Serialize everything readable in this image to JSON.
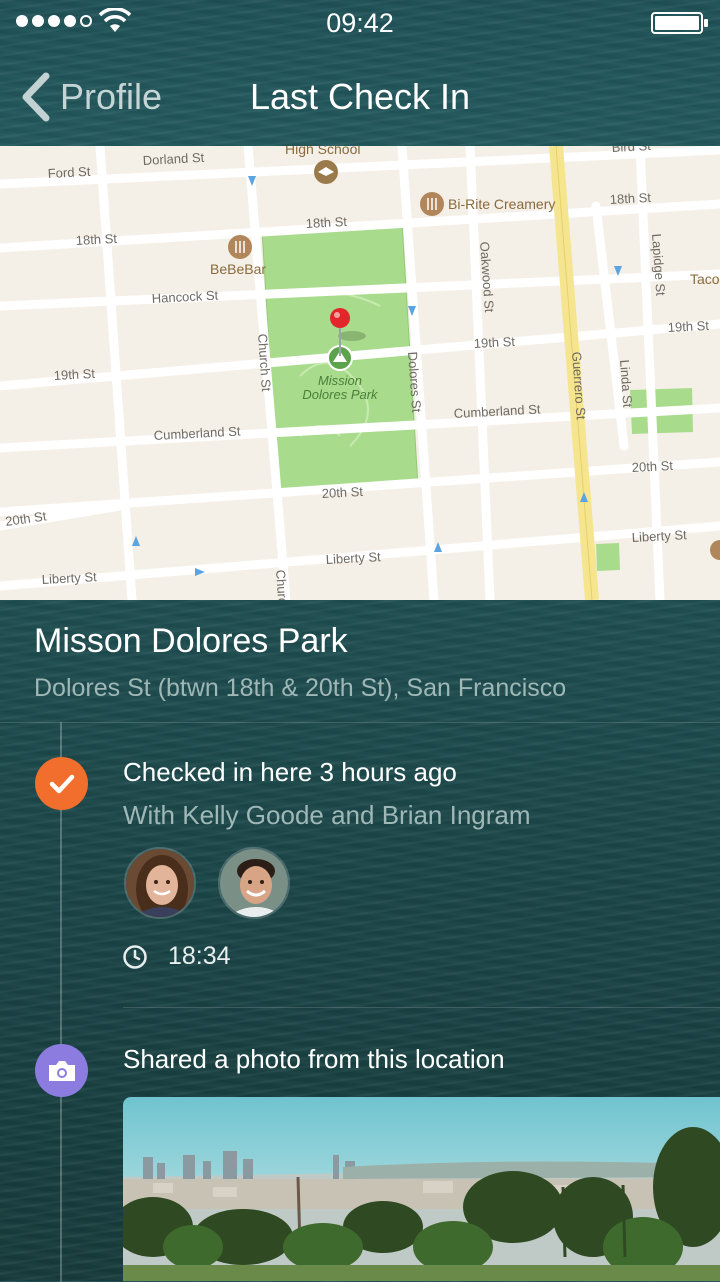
{
  "status_bar": {
    "time": "09:42",
    "signal_bars": 4,
    "signal_total": 5
  },
  "nav": {
    "back_label": "Profile",
    "title": "Last Check In"
  },
  "map": {
    "streets": [
      "Dorland St",
      "Ford St",
      "18th St",
      "Hancock St",
      "19th St",
      "Cumberland St",
      "20th St",
      "Liberty St",
      "Church St",
      "Dolores St",
      "Oakwood St",
      "Guerrero St",
      "Lapidge St",
      "Linda St",
      "Bird St",
      "Church"
    ],
    "pois": [
      "High School",
      "Bi-Rite Creamery",
      "BeBeBar",
      "Taco"
    ],
    "park_label_line1": "Mission",
    "park_label_line2": "Dolores Park",
    "colors": {
      "land": "#f4efe7",
      "park": "#a8dc8c",
      "road": "#ffffff",
      "highway": "#f6e58f",
      "pin": "#e2262b"
    }
  },
  "venue": {
    "name": "Misson Dolores Park",
    "address": "Dolores St (btwn 18th & 20th St), San Francisco"
  },
  "checkin": {
    "icon": "check-icon",
    "title": "Checked in here 3 hours ago",
    "with_text": "With Kelly Goode and Brian Ingram",
    "time": "18:34",
    "accent": "#f26e2c"
  },
  "photo_share": {
    "icon": "camera-icon",
    "title": "Shared a photo from this location",
    "accent": "#8c7ce0"
  }
}
